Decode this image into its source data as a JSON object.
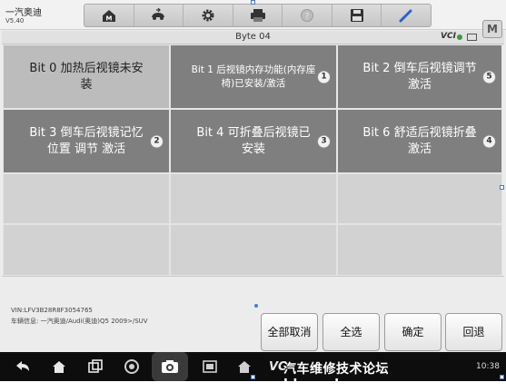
{
  "app": {
    "title": "一汽奥迪",
    "version": "V5.40"
  },
  "toolbar": {
    "icons": [
      "home-icon",
      "vehicle-swap-icon",
      "settings-gear-icon",
      "print-icon",
      "help-icon",
      "save-icon",
      "edit-pen-icon"
    ]
  },
  "m_button": "M",
  "header": {
    "title": "Byte 04",
    "vci": "VCI"
  },
  "grid": {
    "cells": [
      {
        "label": "Bit 0 加热后视镜未安装",
        "state": "on",
        "badge": ""
      },
      {
        "label": "Bit 1 后视镜内存功能(内存座椅)已安装/激活",
        "state": "off",
        "badge": "1"
      },
      {
        "label": "Bit 2 倒车后视镜调节激活",
        "state": "off",
        "badge": "5"
      },
      {
        "label": "Bit 3 倒车后视镜记忆位置 调节 激活",
        "state": "off",
        "badge": "2"
      },
      {
        "label": "Bit 4 可折叠后视镜已安装",
        "state": "off",
        "badge": "3"
      },
      {
        "label": "Bit 6 舒适后视镜折叠激活",
        "state": "off",
        "badge": "4"
      }
    ]
  },
  "footer": {
    "vin": "VIN:LFV3B28R8F3054765",
    "vehicle_info": "车辆信息: 一汽奥迪/Audi(奥迪)Q5 2009>/SUV",
    "buttons": {
      "deselect_all": "全部取消",
      "select_all": "全选",
      "confirm": "确定",
      "back": "回退"
    }
  },
  "navbar": {
    "vc_logo": "VC",
    "watermark": "汽车维修技术论坛 bbs.ephua.com",
    "clock": "10:38"
  },
  "colors": {
    "selected_cell": "#bcbcbc",
    "unselected_cell": "#7f7f7f",
    "navbar": "#0d0d0d",
    "accent": "#3f7fd0"
  }
}
